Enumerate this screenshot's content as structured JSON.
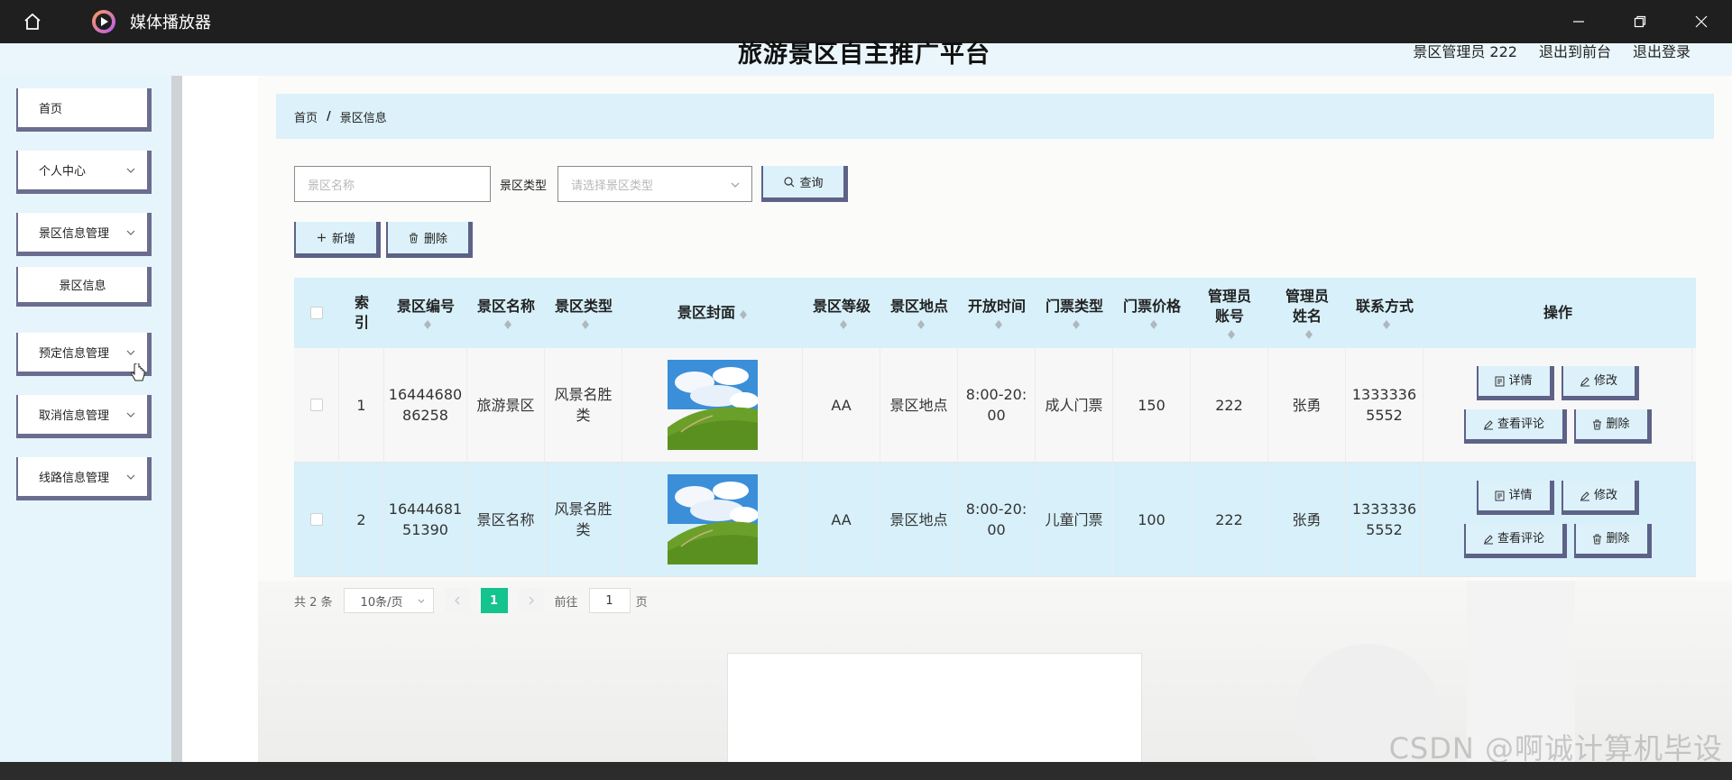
{
  "window": {
    "app_title": "媒体播放器"
  },
  "site": {
    "title": "旅游景区自主推广平台",
    "links": [
      "景区管理员 222",
      "退出到前台",
      "退出登录"
    ]
  },
  "sidebar": {
    "items": [
      {
        "label": "首页",
        "has_chevron": false
      },
      {
        "label": "个人中心",
        "has_chevron": true
      },
      {
        "label": "景区信息管理",
        "has_chevron": true
      },
      {
        "label": "景区信息",
        "has_chevron": false
      },
      {
        "label": "预定信息管理",
        "has_chevron": true
      },
      {
        "label": "取消信息管理",
        "has_chevron": true
      },
      {
        "label": "线路信息管理",
        "has_chevron": true
      }
    ]
  },
  "breadcrumb": {
    "home": "首页",
    "separator": "/",
    "current": "景区信息"
  },
  "search": {
    "name_placeholder": "景区名称",
    "type_label": "景区类型",
    "type_placeholder": "请选择景区类型",
    "query_label": "查询"
  },
  "actions": {
    "add_label": "新增",
    "delete_label": "删除"
  },
  "table": {
    "headers": {
      "index": "索引",
      "no": "景区编号",
      "name": "景区名称",
      "type": "景区类型",
      "cover": "景区封面",
      "level": "景区等级",
      "location": "景区地点",
      "open_time": "开放时间",
      "ticket_type": "门票类型",
      "price": "门票价格",
      "admin_account": "管理员账号",
      "admin_name": "管理员姓名",
      "phone": "联系方式",
      "ops": "操作"
    },
    "rows": [
      {
        "index": "1",
        "no": "1644468086258",
        "name": "旅游景区",
        "type": "风景名胜类",
        "level": "AA",
        "location": "景区地点",
        "open_time": "8:00-20:00",
        "ticket_type": "成人门票",
        "price": "150",
        "admin_account": "222",
        "admin_name": "张勇",
        "phone": "13333365552"
      },
      {
        "index": "2",
        "no": "1644468151390",
        "name": "景区名称",
        "type": "风景名胜类",
        "level": "AA",
        "location": "景区地点",
        "open_time": "8:00-20:00",
        "ticket_type": "儿童门票",
        "price": "100",
        "admin_account": "222",
        "admin_name": "张勇",
        "phone": "13333365552"
      }
    ],
    "op_labels": {
      "detail": "详情",
      "edit": "修改",
      "comments": "查看评论",
      "delete": "删除"
    }
  },
  "pagination": {
    "total": "共 2 条",
    "page_size": "10条/页",
    "current_page": "1",
    "goto_prefix": "前往",
    "goto_value": "1",
    "goto_suffix": "页"
  },
  "watermark": "CSDN @啊诚计算机毕设",
  "colors": {
    "accent": "#14c38e",
    "light_blue": "#d7f0fa",
    "border_3d": "#5e6287"
  }
}
